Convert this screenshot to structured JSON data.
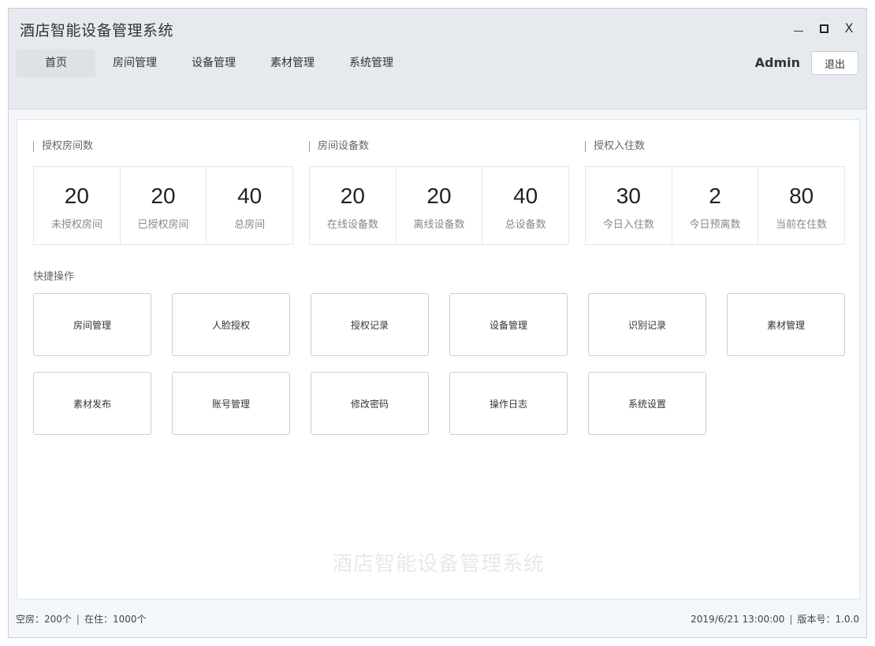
{
  "app": {
    "title": "酒店智能设备管理系统"
  },
  "window_controls": {
    "minimize": "—",
    "maximize": "□",
    "close": "X"
  },
  "nav": {
    "items": [
      {
        "label": "首页"
      },
      {
        "label": "房间管理"
      },
      {
        "label": "设备管理"
      },
      {
        "label": "素材管理"
      },
      {
        "label": "系统管理"
      }
    ],
    "active_index": 0
  },
  "user": {
    "name": "Admin",
    "logout_label": "退出"
  },
  "stats": [
    {
      "title": "授权房间数",
      "cells": [
        {
          "value": "20",
          "label": "未授权房间"
        },
        {
          "value": "20",
          "label": "已授权房间"
        },
        {
          "value": "40",
          "label": "总房间"
        }
      ]
    },
    {
      "title": "房间设备数",
      "cells": [
        {
          "value": "20",
          "label": "在线设备数"
        },
        {
          "value": "20",
          "label": "离线设备数"
        },
        {
          "value": "40",
          "label": "总设备数"
        }
      ]
    },
    {
      "title": "授权入住数",
      "cells": [
        {
          "value": "30",
          "label": "今日入住数"
        },
        {
          "value": "2",
          "label": "今日预离数"
        },
        {
          "value": "80",
          "label": "当前在住数"
        }
      ]
    }
  ],
  "quick": {
    "title": "快捷操作",
    "items": [
      {
        "label": "房间管理"
      },
      {
        "label": "人脸授权"
      },
      {
        "label": "授权记录"
      },
      {
        "label": "设备管理"
      },
      {
        "label": "识别记录"
      },
      {
        "label": "素材管理"
      },
      {
        "label": "素材发布"
      },
      {
        "label": "账号管理"
      },
      {
        "label": "修改密码"
      },
      {
        "label": "操作日志"
      },
      {
        "label": "系统设置"
      }
    ]
  },
  "watermark": "酒店智能设备管理系统",
  "status": {
    "vacant": "空房：200个",
    "occupied": "在住：1000个",
    "separator": "|",
    "datetime": "2019/6/21 13:00:00",
    "version": "版本号：1.0.0"
  }
}
